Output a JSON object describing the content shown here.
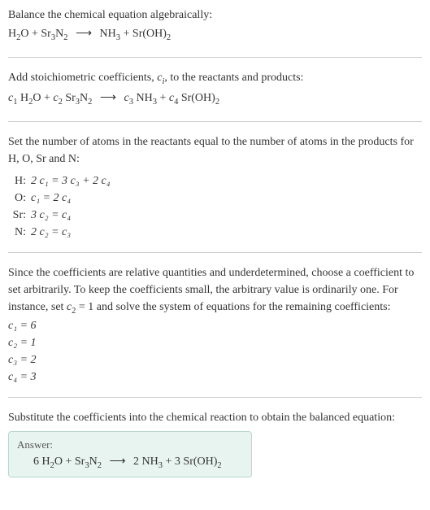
{
  "section1": {
    "intro": "Balance the chemical equation algebraically:",
    "eq_lhs1": "H",
    "eq_lhs1_sub": "2",
    "eq_lhs2": "O + Sr",
    "eq_lhs2_sub": "3",
    "eq_lhs3": "N",
    "eq_lhs3_sub": "2",
    "arrow": "⟶",
    "eq_rhs1": "NH",
    "eq_rhs1_sub": "3",
    "eq_rhs2": " + Sr(OH)",
    "eq_rhs2_sub": "2"
  },
  "section2": {
    "intro1": "Add stoichiometric coefficients, ",
    "ci": "c",
    "ci_sub": "i",
    "intro2": ", to the reactants and products:",
    "c1": "c",
    "c1s": "1",
    "t1": " H",
    "t1s": "2",
    "t1b": "O + ",
    "c2": "c",
    "c2s": "2",
    "t2": " Sr",
    "t2s": "3",
    "t2b": "N",
    "t2c": "2",
    "arrow": "⟶",
    "c3": "c",
    "c3s": "3",
    "t3": " NH",
    "t3s": "3",
    "t3b": " + ",
    "c4": "c",
    "c4s": "4",
    "t4": " Sr(OH)",
    "t4s": "2"
  },
  "section3": {
    "intro": "Set the number of atoms in the reactants equal to the number of atoms in the products for H, O, Sr and N:",
    "rows": {
      "H": {
        "label": "H:",
        "eq": "2 c₁ = 3 c₃ + 2 c₄"
      },
      "O": {
        "label": "O:",
        "eq": "c₁ = 2 c₄"
      },
      "Sr": {
        "label": "Sr:",
        "eq": "3 c₂ = c₄"
      },
      "N": {
        "label": "N:",
        "eq": "2 c₂ = c₃"
      }
    }
  },
  "section4": {
    "intro1": "Since the coefficients are relative quantities and underdetermined, choose a coefficient to set arbitrarily. To keep the coefficients small, the arbitrary value is ordinarily one. For instance, set ",
    "cset": "c",
    "cset_sub": "2",
    "intro2": " = 1 and solve the system of equations for the remaining coefficients:",
    "s1": "c₁ = 6",
    "s2": "c₂ = 1",
    "s3": "c₃ = 2",
    "s4": "c₄ = 3"
  },
  "section5": {
    "intro": "Substitute the coefficients into the chemical reaction to obtain the balanced equation:",
    "answer_label": "Answer:",
    "a1": "6 H",
    "a1s": "2",
    "a2": "O + Sr",
    "a2s": "3",
    "a3": "N",
    "a3s": "2",
    "arrow": "⟶",
    "a4": "2 NH",
    "a4s": "3",
    "a5": " + 3 Sr(OH)",
    "a5s": "2"
  },
  "chart_data": {
    "type": "table",
    "title": "Balanced chemical equation",
    "reactants": [
      {
        "species": "H2O",
        "coefficient": 6
      },
      {
        "species": "Sr3N2",
        "coefficient": 1
      }
    ],
    "products": [
      {
        "species": "NH3",
        "coefficient": 2
      },
      {
        "species": "Sr(OH)2",
        "coefficient": 3
      }
    ],
    "atom_balance": [
      {
        "element": "H",
        "equation": "2 c1 = 3 c3 + 2 c4"
      },
      {
        "element": "O",
        "equation": "c1 = 2 c4"
      },
      {
        "element": "Sr",
        "equation": "3 c2 = c4"
      },
      {
        "element": "N",
        "equation": "2 c2 = c3"
      }
    ],
    "solution": {
      "c1": 6,
      "c2": 1,
      "c3": 2,
      "c4": 3
    }
  }
}
